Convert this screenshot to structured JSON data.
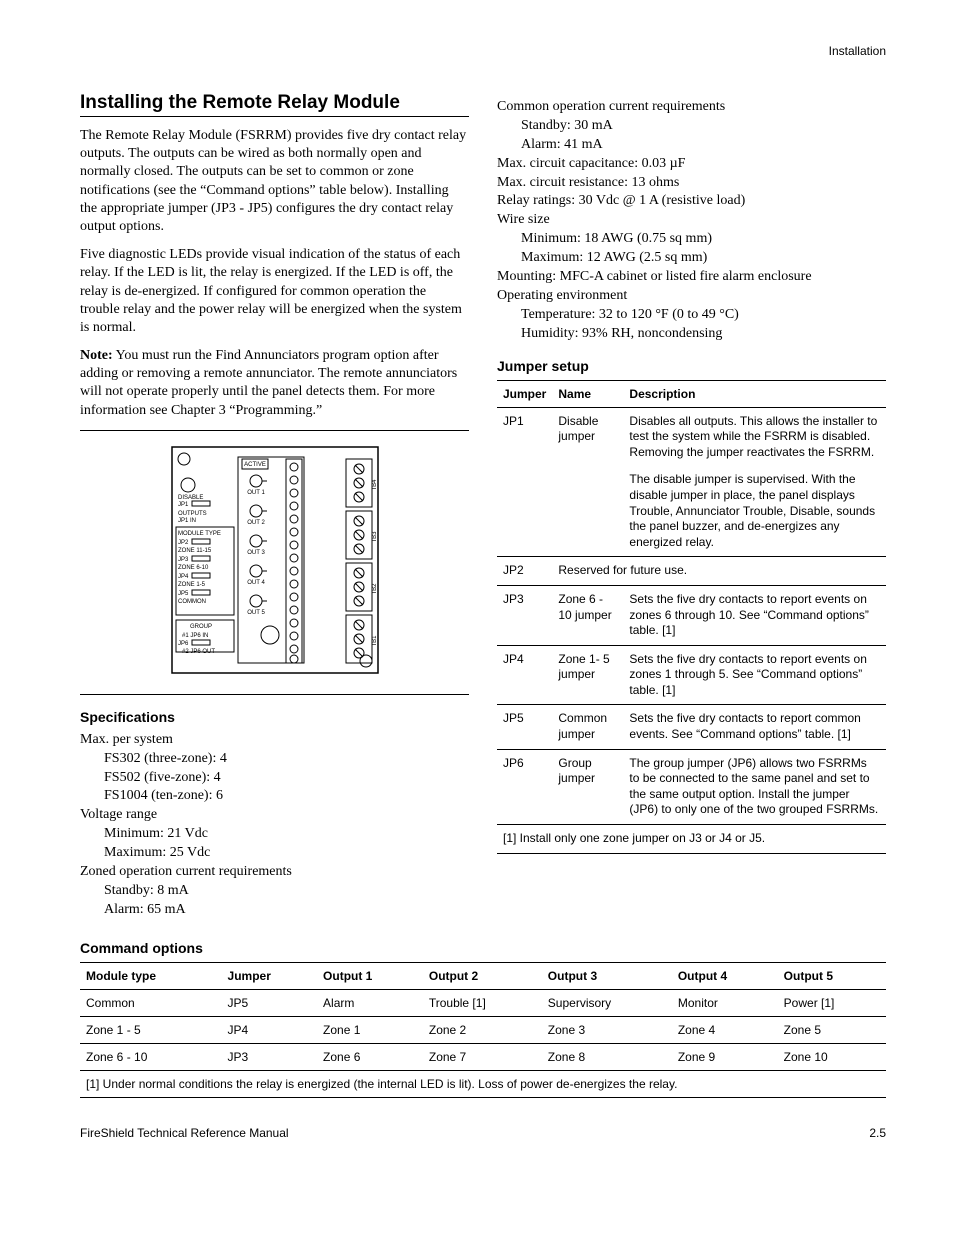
{
  "header": {
    "section": "Installation"
  },
  "title": "Installing the Remote Relay Module",
  "paragraphs": {
    "p1": "The Remote Relay Module (FSRRM) provides five dry contact relay outputs. The outputs can be wired as both normally open and normally closed. The outputs can be set to common or zone notifications (see the “Command options” table below). Installing the appropriate jumper (JP3 - JP5) configures the dry contact relay output options.",
    "p2": "Five diagnostic LEDs provide visual indication of the status of each relay. If the LED is lit, the relay is energized. If the LED is off, the relay is de-energized. If configured for common operation the trouble relay and the power relay will be energized when the system is normal.",
    "p3_prefix": "Note:",
    "p3": " You must run the Find Annunciators program option after adding or removing a remote annunciator. The remote annunciators will not operate properly until the panel detects them. For more information see Chapter 3 “Programming.”"
  },
  "diagram_labels": {
    "active": "ACTIVE",
    "disable": "DISABLE",
    "jp1": "JP1",
    "outputs": "OUTPUTS",
    "jp1in": "JP1 IN",
    "module_type": "MODULE TYPE",
    "jp2": "JP2",
    "zone1115": "ZONE 11-15",
    "jp3": "JP3",
    "zone610": "ZONE 6-10",
    "jp4": "JP4",
    "zone15": "ZONE 1-5",
    "jp5": "JP5",
    "common": "COMMON",
    "group": "GROUP",
    "jp6": "JP6",
    "n1in": "#1 JP6 IN",
    "n2out": "#2 JP6 OUT",
    "out1": "OUT 1",
    "out2": "OUT 2",
    "out3": "OUT 3",
    "out4": "OUT 4",
    "out5": "OUT 5",
    "tb1": "TB1",
    "tb2": "TB2",
    "tb3": "TB3",
    "tb4": "TB4"
  },
  "spec_heading": "Specifications",
  "specs_left": [
    {
      "l": 0,
      "t": "Max. per system"
    },
    {
      "l": 1,
      "t": "FS302 (three-zone): 4"
    },
    {
      "l": 1,
      "t": "FS502 (five-zone): 4"
    },
    {
      "l": 1,
      "t": "FS1004 (ten-zone): 6"
    },
    {
      "l": 0,
      "t": "Voltage range"
    },
    {
      "l": 1,
      "t": "Minimum: 21 Vdc"
    },
    {
      "l": 1,
      "t": "Maximum: 25 Vdc"
    },
    {
      "l": 0,
      "t": "Zoned operation current requirements"
    },
    {
      "l": 1,
      "t": "Standby: 8 mA"
    },
    {
      "l": 1,
      "t": "Alarm: 65 mA"
    }
  ],
  "specs_right": [
    {
      "l": 0,
      "t": "Common operation current requirements"
    },
    {
      "l": 1,
      "t": "Standby: 30 mA"
    },
    {
      "l": 1,
      "t": "Alarm: 41 mA"
    },
    {
      "l": 0,
      "t": "Max. circuit capacitance: 0.03 µF"
    },
    {
      "l": 0,
      "t": "Max. circuit resistance: 13 ohms"
    },
    {
      "l": 0,
      "t": "Relay ratings: 30 Vdc @ 1 A (resistive load)"
    },
    {
      "l": 0,
      "t": "Wire size"
    },
    {
      "l": 1,
      "t": "Minimum: 18 AWG (0.75 sq mm)"
    },
    {
      "l": 1,
      "t": "Maximum: 12 AWG (2.5 sq mm)"
    },
    {
      "l": 0,
      "t": "Mounting: MFC-A cabinet or listed fire alarm enclosure"
    },
    {
      "l": 0,
      "t": "Operating environment"
    },
    {
      "l": 1,
      "t": "Temperature: 32 to 120 °F (0 to 49 °C)"
    },
    {
      "l": 1,
      "t": "Humidity: 93% RH, noncondensing"
    }
  ],
  "jumper_heading": "Jumper setup",
  "jumper_table": {
    "headers": [
      "Jumper",
      "Name",
      "Description"
    ],
    "rows": [
      {
        "jumper": "JP1",
        "name": "Disable jumper",
        "desc": "Disables all outputs. This allows the installer to test the system while the FSRRM is disabled. Removing the jumper reactivates the FSRRM.",
        "cont": "The disable jumper is supervised. With the disable jumper in place, the panel displays Trouble, Annunciator Trouble, Disable, sounds the panel buzzer, and de-energizes any energized relay."
      },
      {
        "jumper": "JP2",
        "name": "",
        "desc": "Reserved for future use.",
        "span": true
      },
      {
        "jumper": "JP3",
        "name": "Zone 6 - 10 jumper",
        "desc": "Sets the five dry contacts to report events on zones 6 through 10. See “Command options” table. [1]"
      },
      {
        "jumper": "JP4",
        "name": "Zone 1- 5 jumper",
        "desc": "Sets the five dry contacts to report events on zones 1 through 5. See “Command options” table. [1]"
      },
      {
        "jumper": "JP5",
        "name": "Common jumper",
        "desc": "Sets the five dry contacts to report common events. See “Command options” table. [1]"
      },
      {
        "jumper": "JP6",
        "name": "Group jumper",
        "desc": "The group jumper (JP6) allows two FSRRMs to be connected to the same panel and set to the same output option. Install the jumper (JP6) to only one of the two grouped FSRRMs."
      }
    ],
    "footnote": "[1] Install only one zone jumper on J3 or J4 or J5."
  },
  "command_heading": "Command options",
  "command_table": {
    "headers": [
      "Module type",
      "Jumper",
      "Output 1",
      "Output 2",
      "Output 3",
      "Output 4",
      "Output 5"
    ],
    "rows": [
      [
        "Common",
        "JP5",
        "Alarm",
        "Trouble [1]",
        "Supervisory",
        "Monitor",
        "Power [1]"
      ],
      [
        "Zone 1 - 5",
        "JP4",
        "Zone 1",
        "Zone 2",
        "Zone 3",
        "Zone 4",
        "Zone 5"
      ],
      [
        "Zone 6 - 10",
        "JP3",
        "Zone 6",
        "Zone 7",
        "Zone 8",
        "Zone 9",
        "Zone 10"
      ]
    ],
    "footnote": "[1] Under normal conditions the relay is energized (the internal LED is lit). Loss of power de-energizes the relay."
  },
  "footer": {
    "left": "FireShield Technical Reference Manual",
    "right": "2.5"
  }
}
